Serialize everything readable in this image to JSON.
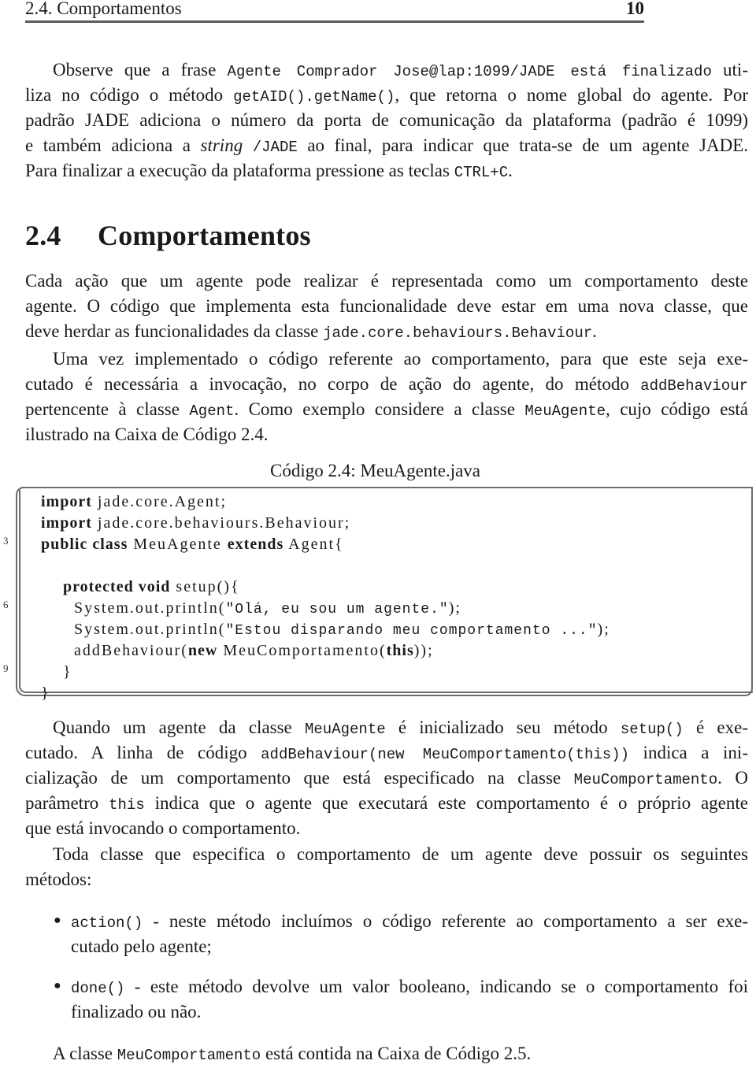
{
  "running_header": {
    "title": "2.4. Comportamentos",
    "page": "10"
  },
  "para1": {
    "l1": [
      "Observe que a frase ",
      "Agente Comprador Jose@lap:1099/JADE está finalizado",
      " uti-"
    ],
    "l2": [
      "liza no código o método ",
      "getAID().getName()",
      ", que retorna o nome global do agente. Por"
    ],
    "l3": "padrão JADE adiciona o número da porta de comunicação da plataforma (padrão é 1099)",
    "l4": [
      "e também adiciona a ",
      "string",
      " ",
      "/JADE",
      " ao final, para indicar que trata-se de um agente JADE."
    ],
    "l5": [
      "Para finalizar a execução da plataforma pressione as teclas ",
      "CTRL+C",
      "."
    ]
  },
  "section": {
    "number": "2.4",
    "title": "Comportamentos"
  },
  "para2": {
    "l1": "Cada ação que um agente pode realizar é representada como um comportamento deste",
    "l2": "agente. O código que implementa esta funcionalidade deve estar em uma nova classe, que",
    "l3": [
      "deve herdar as funcionalidades da classe ",
      "jade.core.behaviours.Behaviour",
      "."
    ]
  },
  "para3": {
    "l1": "Uma vez implementado o código referente ao comportamento, para que este seja exe-",
    "l2": [
      "cutado é necessária a invocação, no corpo de ação do agente, do método ",
      "addBehaviour"
    ],
    "l3": [
      "pertencente à classe ",
      "Agent",
      ". Como exemplo considere a classe ",
      "MeuAgente",
      ", cujo código está"
    ],
    "l4": "ilustrado na Caixa de Código 2.4."
  },
  "listing": {
    "caption": "Código 2.4: MeuAgente.java",
    "line_numbers": [
      "3",
      "6",
      "9"
    ],
    "lines": [
      [
        {
          "k": "import"
        },
        {
          "t": " jade.core.Agent;"
        }
      ],
      [
        {
          "k": "import"
        },
        {
          "t": " jade.core.behaviours.Behaviour;"
        }
      ],
      [
        {
          "k": "public class"
        },
        {
          "t": " MeuAgente "
        },
        {
          "k": "extends"
        },
        {
          "t": " Agent{"
        }
      ],
      [],
      [
        {
          "t": "    "
        },
        {
          "k": "protected void"
        },
        {
          "t": " setup(){"
        }
      ],
      [
        {
          "t": "      System.out.println("
        },
        {
          "s": "\"Olá, eu sou um agente.\""
        },
        {
          "t": ");"
        }
      ],
      [
        {
          "t": "      System.out.println("
        },
        {
          "s": "\"Estou disparando meu comportamento ...\""
        },
        {
          "t": ");"
        }
      ],
      [
        {
          "t": "      addBehaviour("
        },
        {
          "k": "new"
        },
        {
          "t": " MeuComportamento("
        },
        {
          "k": "this"
        },
        {
          "t": "));"
        }
      ],
      [
        {
          "t": "    }"
        }
      ],
      [
        {
          "t": "}"
        }
      ]
    ]
  },
  "para4": {
    "l1": [
      "Quando um agente da classe ",
      "MeuAgente",
      " é inicializado seu método ",
      "setup()",
      " é exe-"
    ],
    "l2": [
      "cutado. A linha de código ",
      "addBehaviour(new MeuComportamento(this))",
      " indica a ini-"
    ],
    "l3": [
      "cialização de um comportamento que está especificado na classe ",
      "MeuComportamento",
      ". O"
    ],
    "l4": [
      "parâmetro ",
      "this",
      " indica que o agente que executará este comportamento é o próprio agente"
    ],
    "l5": "que está invocando o comportamento."
  },
  "para5": {
    "l1": "Toda classe que especifica o comportamento de um agente deve possuir os seguintes",
    "l2": "métodos:"
  },
  "list": [
    {
      "code": "action()",
      "l1": " - neste método incluímos o código referente ao comportamento a ser exe-",
      "l2": "cutado pelo agente;"
    },
    {
      "code": "done()",
      "l1": " - este método devolve um valor booleano, indicando se o comportamento foi",
      "l2": "finalizado ou não."
    }
  ],
  "para6": [
    "A classe ",
    "MeuComportamento",
    " está contida na Caixa de Código 2.5."
  ]
}
